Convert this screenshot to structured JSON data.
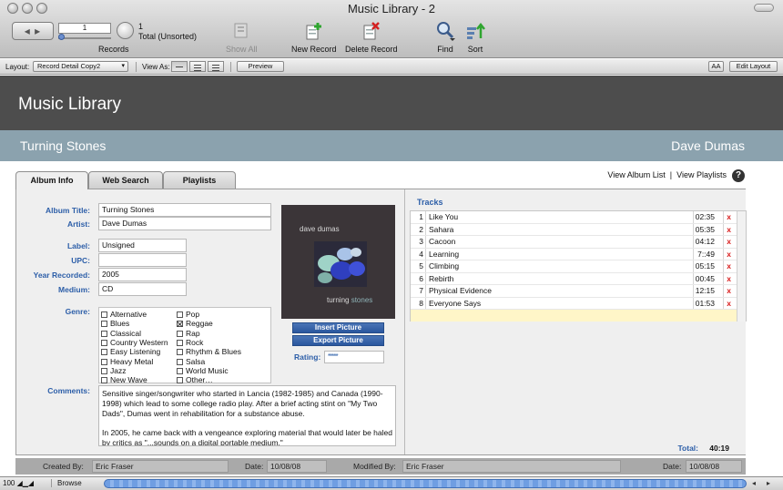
{
  "window": {
    "title": "Music Library - 2"
  },
  "toolbar": {
    "record_number": "1",
    "record_count": "1",
    "record_total": "Total (Unsorted)",
    "records_label": "Records",
    "show_all": "Show All",
    "new_record": "New Record",
    "delete_record": "Delete Record",
    "find": "Find",
    "sort": "Sort"
  },
  "layout_bar": {
    "layout_label": "Layout:",
    "layout_value": "Record Detail Copy2",
    "view_as_label": "View As:",
    "preview": "Preview",
    "font_btn": "AA",
    "edit_layout": "Edit Layout"
  },
  "header": {
    "app_title": "Music Library",
    "album_title": "Turning Stones",
    "artist": "Dave Dumas"
  },
  "tabs": [
    {
      "label": "Album Info",
      "active": true
    },
    {
      "label": "Web Search",
      "active": false
    },
    {
      "label": "Playlists",
      "active": false
    }
  ],
  "links": {
    "view_album_list": "View Album List",
    "sep": "|",
    "view_playlists": "View Playlists",
    "help": "?"
  },
  "form": {
    "labels": {
      "album_title": "Album Title:",
      "artist": "Artist:",
      "label": "Label:",
      "upc": "UPC:",
      "year": "Year Recorded:",
      "medium": "Medium:",
      "genre": "Genre:",
      "comments": "Comments:"
    },
    "values": {
      "album_title": "Turning Stones",
      "artist": "Dave Dumas",
      "label": "Unsigned",
      "upc": "",
      "year": "2005",
      "medium": "CD"
    },
    "genres": [
      {
        "name": "Alternative",
        "checked": false
      },
      {
        "name": "Blues",
        "checked": false
      },
      {
        "name": "Classical",
        "checked": false
      },
      {
        "name": "Country Western",
        "checked": false
      },
      {
        "name": "Easy Listening",
        "checked": false
      },
      {
        "name": "Heavy Metal",
        "checked": false
      },
      {
        "name": "Jazz",
        "checked": false
      },
      {
        "name": "New Wave",
        "checked": false
      },
      {
        "name": "Pop",
        "checked": false
      },
      {
        "name": "Reggae",
        "checked": true
      },
      {
        "name": "Rap",
        "checked": false
      },
      {
        "name": "Rock",
        "checked": false
      },
      {
        "name": "Rhythm & Blues",
        "checked": false
      },
      {
        "name": "Salsa",
        "checked": false
      },
      {
        "name": "World Music",
        "checked": false
      },
      {
        "name": "Other…",
        "checked": false
      }
    ],
    "comments": [
      "Sensitive singer/songwriter who started in Lancia (1982-1985) and Canada (1990-1998) which lead to some college radio play. After a brief acting stint on \"My Two Dads\", Dumas went in rehabilitation for a substance abuse.",
      "In 2005, he came back with a vengeance exploring material that would later be haled by critics as \"...sounds on a digital portable medium.\""
    ]
  },
  "artwork": {
    "artist_text": "dave dumas",
    "title_word1": "turning",
    "title_word2": "stones",
    "insert_picture": "Insert Picture",
    "export_picture": "Export Picture",
    "rating_label": "Rating:",
    "rating_value": "*****",
    "stone_colors": [
      "#9fd3c7",
      "#2f3fbf",
      "#3f51d8",
      "#a9c3e8",
      "#7fb0a8",
      "#c9d8e6"
    ]
  },
  "tracks": {
    "label": "Tracks",
    "rows": [
      {
        "num": "1",
        "name": "Like You",
        "time": "02:35"
      },
      {
        "num": "2",
        "name": "Sahara",
        "time": "05:35"
      },
      {
        "num": "3",
        "name": "Cacoon",
        "time": "04:12"
      },
      {
        "num": "4",
        "name": "Learning",
        "time": "7::49"
      },
      {
        "num": "5",
        "name": "Climbing",
        "time": "05:15"
      },
      {
        "num": "6",
        "name": "Rebirth",
        "time": "00:45"
      },
      {
        "num": "7",
        "name": "Physical Evidence",
        "time": "12:15"
      },
      {
        "num": "8",
        "name": "Everyone Says",
        "time": "01:53"
      }
    ],
    "delete_glyph": "x",
    "total_label": "Total:",
    "total_value": "40:19"
  },
  "footer": {
    "created_by_label": "Created By:",
    "created_by": "Eric Fraser",
    "date_label": "Date:",
    "created_date": "10/08/08",
    "modified_by_label": "Modified By:",
    "modified_by": "Eric Fraser",
    "modified_date": "10/08/08"
  },
  "status": {
    "zoom": "100",
    "mode": "Browse"
  },
  "colors": {
    "header_bg": "#4d4d4d",
    "band_bg": "#8ba2ae",
    "label_blue": "#2c5ea8",
    "button_blue": "#2a579e",
    "delete_red": "#d81c1c",
    "empty_row": "#fff6c8"
  }
}
